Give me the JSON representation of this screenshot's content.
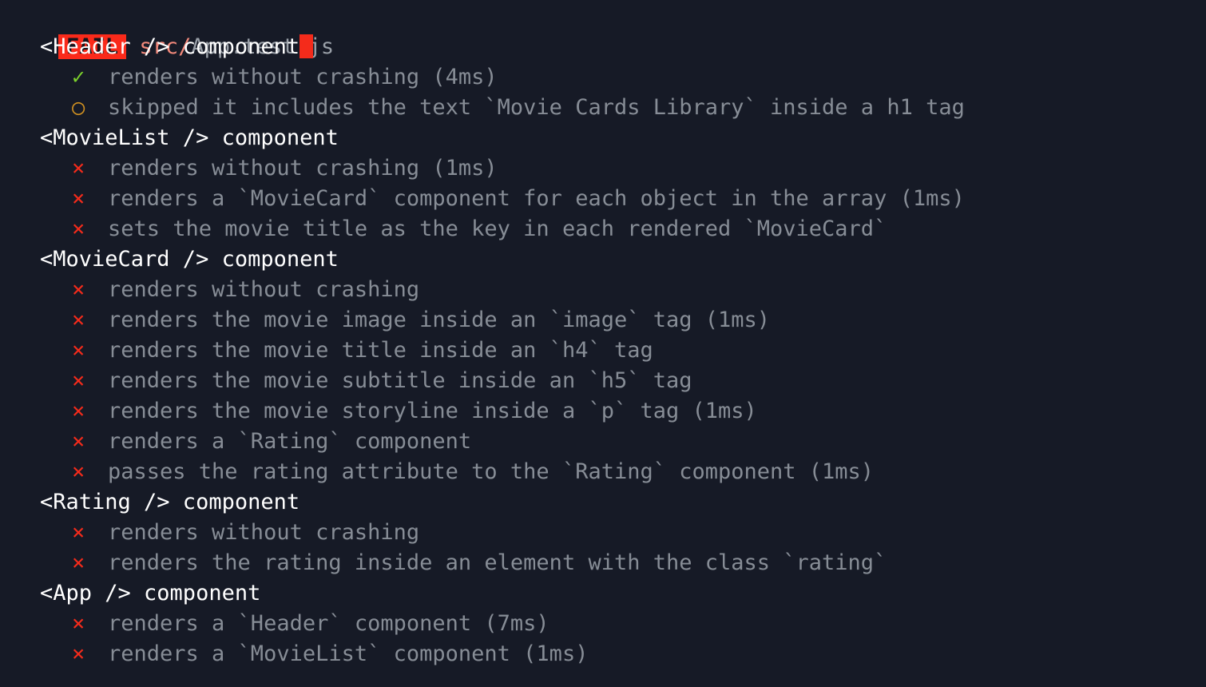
{
  "terminal": {
    "background_color": "#161a26",
    "status": {
      "badge": "FAIL",
      "badge_bg_color": "#fa2a1a",
      "badge_text_color": "#12141c",
      "path_dir": "src/",
      "path_file": "App.test.js",
      "path_dir_color": "#f2897b",
      "path_file_color": "#9aa0a8"
    },
    "cursor": {
      "visible": true,
      "color": "#f42b1b",
      "after_line": "<Header /> component"
    },
    "markers": {
      "pass": "✓",
      "skip": "○",
      "fail": "×",
      "pass_color": "#7cd12c",
      "skip_color": "#cf9021",
      "fail_color": "#f42b1b"
    },
    "suites": [
      {
        "name": "<Header /> component",
        "has_cursor": true,
        "tests": [
          {
            "status": "pass",
            "label": "renders without crashing (4ms)"
          },
          {
            "status": "skip",
            "label": "skipped it includes the text `Movie Cards Library` inside a h1 tag"
          }
        ]
      },
      {
        "name": "<MovieList /> component",
        "has_cursor": false,
        "tests": [
          {
            "status": "fail",
            "label": "renders without crashing (1ms)"
          },
          {
            "status": "fail",
            "label": "renders a `MovieCard` component for each object in the array (1ms)"
          },
          {
            "status": "fail",
            "label": "sets the movie title as the key in each rendered `MovieCard`"
          }
        ]
      },
      {
        "name": "<MovieCard /> component",
        "has_cursor": false,
        "tests": [
          {
            "status": "fail",
            "label": "renders without crashing"
          },
          {
            "status": "fail",
            "label": "renders the movie image inside an `image` tag (1ms)"
          },
          {
            "status": "fail",
            "label": "renders the movie title inside an `h4` tag"
          },
          {
            "status": "fail",
            "label": "renders the movie subtitle inside an `h5` tag"
          },
          {
            "status": "fail",
            "label": "renders the movie storyline inside a `p` tag (1ms)"
          },
          {
            "status": "fail",
            "label": "renders a `Rating` component"
          },
          {
            "status": "fail",
            "label": "passes the rating attribute to the `Rating` component (1ms)"
          }
        ]
      },
      {
        "name": "<Rating /> component",
        "has_cursor": false,
        "tests": [
          {
            "status": "fail",
            "label": "renders without crashing"
          },
          {
            "status": "fail",
            "label": "renders the rating inside an element with the class `rating`"
          }
        ]
      },
      {
        "name": "<App /> component",
        "has_cursor": false,
        "tests": [
          {
            "status": "fail",
            "label": "renders a `Header` component (7ms)"
          },
          {
            "status": "fail",
            "label": "renders a `MovieList` component (1ms)"
          }
        ]
      }
    ]
  }
}
